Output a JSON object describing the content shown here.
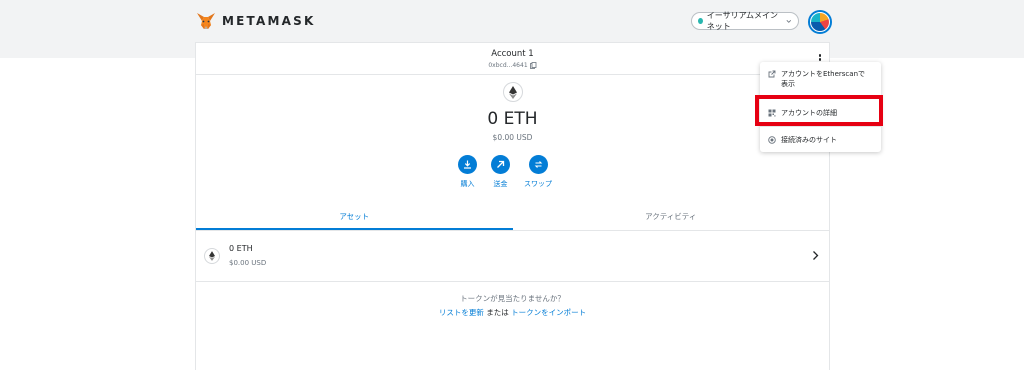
{
  "app": {
    "brand": "METAMASK"
  },
  "network": {
    "label": "イーサリアムメインネット",
    "dot_color": "#29b6af"
  },
  "account": {
    "name": "Account 1",
    "address": "0xbcd...4641"
  },
  "wallet": {
    "balance": "0 ETH",
    "balance_usd": "$0.00 USD"
  },
  "actions": {
    "buy": "購入",
    "send": "送金",
    "swap": "スワップ"
  },
  "tabs": {
    "assets": "アセット",
    "activity": "アクティビティ",
    "active": "アセット"
  },
  "assets": [
    {
      "name": "0 ETH",
      "usd": "$0.00 USD"
    }
  ],
  "import": {
    "question": "トークンが見当たりませんか？",
    "refresh_link": "リストを更新",
    "or_text": " または ",
    "import_link": "トークンをインポート"
  },
  "account_menu": {
    "view_etherscan_line1": "アカウントをEtherscanで",
    "view_etherscan_line2": "表示",
    "account_details": "アカウントの詳細",
    "connected_sites": "接続済みのサイト"
  },
  "colors": {
    "accent": "#037dd6",
    "highlight": "#e60012",
    "background": "#f2f3f4"
  },
  "icons": [
    "fox-logo-icon",
    "chevron-down-icon",
    "ethereum-icon",
    "copy-icon",
    "kebab-menu-icon",
    "download-icon",
    "arrow-up-right-icon",
    "swap-icon",
    "chevron-right-icon",
    "external-link-icon",
    "qr-code-icon",
    "connected-sites-icon"
  ]
}
